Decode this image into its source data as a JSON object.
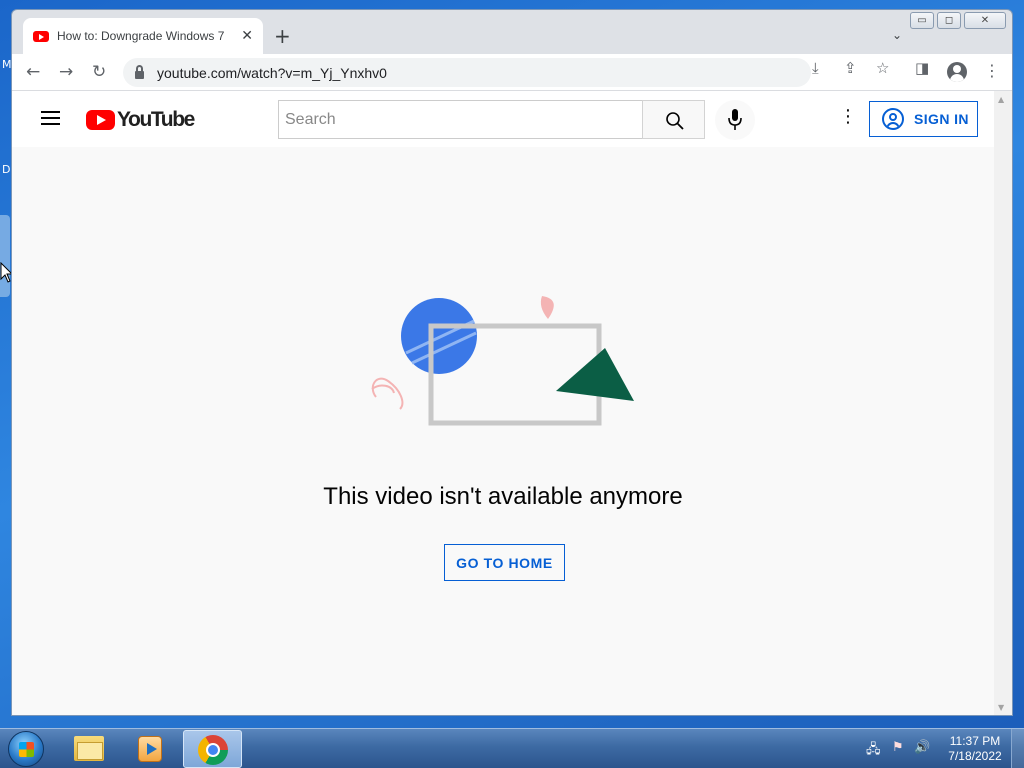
{
  "desktop": {
    "letters": [
      "M",
      "D"
    ]
  },
  "window": {
    "controls": {
      "minimize": "▭",
      "maximize": "◻",
      "close": "✕"
    }
  },
  "browser": {
    "tab": {
      "title": "How to: Downgrade Windows 7 |",
      "close": "✕"
    },
    "new_tab": "+",
    "tab_search": "⌄",
    "nav": {
      "back": "←",
      "forward": "→",
      "reload": "↻"
    },
    "url": "youtube.com/watch?v=m_Yj_Ynxhv0",
    "omnibox_icons": {
      "install": "⤓",
      "share": "⇪",
      "bookmark": "☆"
    },
    "side_panel": "◨",
    "menu": "⋮"
  },
  "youtube": {
    "logo_text": "YouTube",
    "search": {
      "placeholder": "Search"
    },
    "more": "⋮",
    "sign_in_label": "SIGN IN",
    "message": "This video isn't available anymore",
    "home_button_label": "GO TO HOME"
  },
  "taskbar": {
    "clock_time": "11:37 PM",
    "clock_date": "7/18/2022",
    "tray": {
      "network": "🖧",
      "flag": "⚑",
      "volume": "🔊"
    }
  },
  "colors": {
    "youtube_red": "#ff0000",
    "link_blue": "#065fd4",
    "illustration_blue": "#3b78e7",
    "illustration_green": "#0b5e45",
    "illustration_pink": "#f4b4b4"
  }
}
